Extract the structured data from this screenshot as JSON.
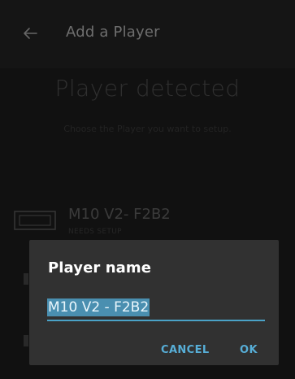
{
  "appbar": {
    "title": "Add a Player",
    "back_icon": "arrow-left-icon"
  },
  "hero": {
    "title": "Player detected",
    "subtitle": "Choose the Player you want to setup."
  },
  "player": {
    "name": "M10 V2- F2B2",
    "status": "NEEDS SETUP",
    "icon": "device-icon"
  },
  "dialog": {
    "title": "Player name",
    "input_value": "M10 V2 - F2B2",
    "cancel_label": "CANCEL",
    "ok_label": "OK"
  },
  "colors": {
    "accent": "#57aed7",
    "selection": "#4a8fb0",
    "dialog_bg": "#313131",
    "screen_bg": "#1a1a1a"
  }
}
